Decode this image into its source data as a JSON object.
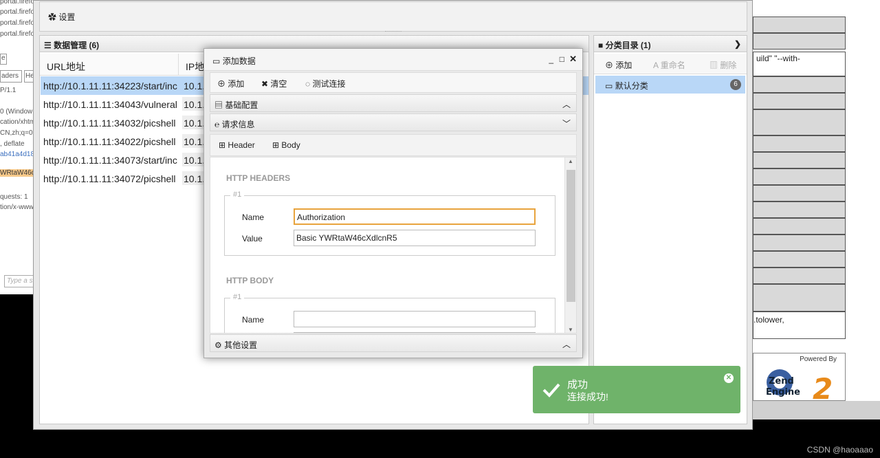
{
  "left_browser": {
    "lines": [
      "portal.firefo",
      "portal.firefo",
      "portal.firefo",
      "portal.firefo",
      "e",
      "aders",
      "He",
      "P/1.1",
      "0 (Window",
      "cation/xhtm",
      "CN,zh;q=0",
      ", deflate",
      "ab41a4d18",
      "WRtaW46c",
      "quests: 1",
      "tion/x-www",
      "Type a s"
    ]
  },
  "right_page": {
    "text_top": "uild\" \"--with-",
    "text_bottom": ".tolower,",
    "powered_by": "Powered By",
    "logo_text": "Zend Engine"
  },
  "app": {
    "settings_label": "设置",
    "data_panel": {
      "title": "数据管理 (6)",
      "columns": [
        "URL地址",
        "IP地"
      ],
      "rows": [
        {
          "url": "http://10.1.11.11:34223/start/inc",
          "ip": "10.1.1"
        },
        {
          "url": "http://10.1.11.11:34043/vulneral",
          "ip": "10.1.1"
        },
        {
          "url": "http://10.1.11.11:34032/picshell",
          "ip": "10.1.1"
        },
        {
          "url": "http://10.1.11.11:34022/picshell",
          "ip": "10.1.1"
        },
        {
          "url": "http://10.1.11.11:34073/start/inc",
          "ip": "10.1.1"
        },
        {
          "url": "http://10.1.11.11:34072/picshell",
          "ip": "10.1.1"
        }
      ]
    },
    "category_panel": {
      "title": "分类目录 (1)",
      "add": "添加",
      "rename": "重命名",
      "delete": "删除",
      "item_label": "默认分类",
      "item_count": "6"
    }
  },
  "modal": {
    "title": "添加数据",
    "toolbar": {
      "add": "添加",
      "clear": "清空",
      "test": "测试连接"
    },
    "sections": {
      "basic": "基础配置",
      "request": "请求信息",
      "other": "其他设置"
    },
    "subtabs": {
      "header": "Header",
      "body": "Body"
    },
    "headers_title": "HTTP HEADERS",
    "body_title": "HTTP BODY",
    "group_legend": "#1",
    "name_label": "Name",
    "value_label": "Value",
    "header_name_value": "Authorization",
    "header_value_value": "Basic YWRtaW46cXdlcnR5",
    "body_name_value": ""
  },
  "toast": {
    "title": "成功",
    "message": "连接成功!"
  },
  "watermark": "CSDN @haoaaao",
  "colors": {
    "toast_bg": "#6fb36a",
    "selected_row": "#b9d7f7",
    "input_focus": "#e8a33c"
  }
}
